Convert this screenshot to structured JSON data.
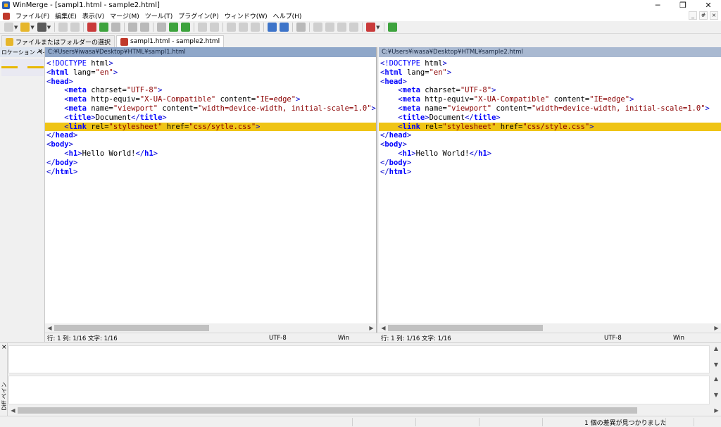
{
  "window": {
    "title": "WinMerge - [sampl1.html - sample2.html]",
    "controls": {
      "minimize": "─",
      "maximize": "❐",
      "close": "✕"
    }
  },
  "menu": {
    "items": [
      "ファイル(F)",
      "編集(E)",
      "表示(V)",
      "マージ(M)",
      "ツール(T)",
      "プラグイン(P)",
      "ウィンドウ(W)",
      "ヘルプ(H)"
    ],
    "mdi": {
      "minimize": "_",
      "restore": "#",
      "close": "×"
    }
  },
  "tabs": [
    {
      "label": "ファイルまたはフォルダーの選択",
      "active": false
    },
    {
      "label": "sampl1.html - sample2.html",
      "active": true
    }
  ],
  "location_pane": {
    "title": "ロケーション ペイン",
    "close": "×"
  },
  "left_pane": {
    "path": "C:¥Users¥iwasa¥Desktop¥HTML¥sampl1.html",
    "status": {
      "position": "行: 1  列: 1/16  文字: 1/16",
      "encoding": "UTF-8",
      "eol": "Win"
    }
  },
  "right_pane": {
    "path": "C:¥Users¥iwasa¥Desktop¥HTML¥sample2.html",
    "status": {
      "position": "行: 1  列: 1/16  文字: 1/16",
      "encoding": "UTF-8",
      "eol": "Win"
    }
  },
  "code_left": [
    "<!DOCTYPE html>",
    "<html lang=\"en\">",
    "<head>",
    "    <meta charset=\"UTF-8\">",
    "    <meta http-equiv=\"X-UA-Compatible\" content=\"IE=edge\">",
    "    <meta name=\"viewport\" content=\"width=device-width, initial-scale=1.0\">",
    "    <title>Document</title>",
    "    <link rel=\"stylesheet\" href=\"css/sytle.css\">",
    "</head>",
    "<body>",
    "    <h1>Hello World!</h1>",
    "</body>",
    "</html>"
  ],
  "code_right": [
    "<!DOCTYPE html>",
    "<html lang=\"en\">",
    "<head>",
    "    <meta charset=\"UTF-8\">",
    "    <meta http-equiv=\"X-UA-Compatible\" content=\"IE=edge\">",
    "    <meta name=\"viewport\" content=\"width=device-width, initial-scale=1.0\">",
    "    <title>Document</title>",
    "    <link rel=\"stylesheet\" href=\"css/style.css\">",
    "</head>",
    "<body>",
    "    <h1>Hello World!</h1>",
    "</body>",
    "</html>"
  ],
  "diff_line_index": 7,
  "diff_pane": {
    "label": "Diff ペイン",
    "close": "×"
  },
  "statusbar": {
    "message": "1 個の差異が見つかりました"
  },
  "colors": {
    "diff_highlight": "#efc416",
    "left_header": "#8fa7c9",
    "right_header": "#a9b9d1"
  }
}
